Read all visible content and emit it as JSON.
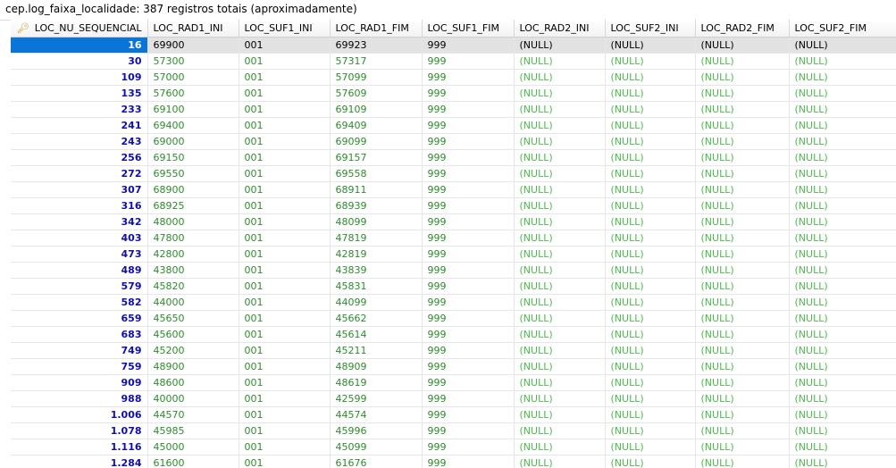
{
  "title": "cep.log_faixa_localidade: 387 registros totais (aproximadamente)",
  "columns": [
    "LOC_NU_SEQUENCIAL",
    "LOC_RAD1_INI",
    "LOC_SUF1_INI",
    "LOC_RAD1_FIM",
    "LOC_SUF1_FIM",
    "LOC_RAD2_INI",
    "LOC_SUF2_INI",
    "LOC_RAD2_FIM",
    "LOC_SUF2_FIM"
  ],
  "primary_key_icon": "key-icon",
  "colors": {
    "selected_cell": "#0a74d8",
    "selected_row": "#e2e2e2",
    "seq_text": "#1010a8",
    "value_text": "#2f8a2f",
    "null_text": "#4fb84f"
  },
  "null_label": "(NULL)",
  "selected_row_index": 0,
  "rows": [
    {
      "seq": "16",
      "rad1_ini": "69900",
      "suf1_ini": "001",
      "rad1_fim": "69923",
      "suf1_fim": "999"
    },
    {
      "seq": "30",
      "rad1_ini": "57300",
      "suf1_ini": "001",
      "rad1_fim": "57317",
      "suf1_fim": "999"
    },
    {
      "seq": "109",
      "rad1_ini": "57000",
      "suf1_ini": "001",
      "rad1_fim": "57099",
      "suf1_fim": "999"
    },
    {
      "seq": "135",
      "rad1_ini": "57600",
      "suf1_ini": "001",
      "rad1_fim": "57609",
      "suf1_fim": "999"
    },
    {
      "seq": "233",
      "rad1_ini": "69100",
      "suf1_ini": "001",
      "rad1_fim": "69109",
      "suf1_fim": "999"
    },
    {
      "seq": "241",
      "rad1_ini": "69400",
      "suf1_ini": "001",
      "rad1_fim": "69409",
      "suf1_fim": "999"
    },
    {
      "seq": "243",
      "rad1_ini": "69000",
      "suf1_ini": "001",
      "rad1_fim": "69099",
      "suf1_fim": "999"
    },
    {
      "seq": "256",
      "rad1_ini": "69150",
      "suf1_ini": "001",
      "rad1_fim": "69157",
      "suf1_fim": "999"
    },
    {
      "seq": "272",
      "rad1_ini": "69550",
      "suf1_ini": "001",
      "rad1_fim": "69558",
      "suf1_fim": "999"
    },
    {
      "seq": "307",
      "rad1_ini": "68900",
      "suf1_ini": "001",
      "rad1_fim": "68911",
      "suf1_fim": "999"
    },
    {
      "seq": "316",
      "rad1_ini": "68925",
      "suf1_ini": "001",
      "rad1_fim": "68939",
      "suf1_fim": "999"
    },
    {
      "seq": "342",
      "rad1_ini": "48000",
      "suf1_ini": "001",
      "rad1_fim": "48099",
      "suf1_fim": "999"
    },
    {
      "seq": "403",
      "rad1_ini": "47800",
      "suf1_ini": "001",
      "rad1_fim": "47819",
      "suf1_fim": "999"
    },
    {
      "seq": "473",
      "rad1_ini": "42800",
      "suf1_ini": "001",
      "rad1_fim": "42819",
      "suf1_fim": "999"
    },
    {
      "seq": "489",
      "rad1_ini": "43800",
      "suf1_ini": "001",
      "rad1_fim": "43839",
      "suf1_fim": "999"
    },
    {
      "seq": "579",
      "rad1_ini": "45820",
      "suf1_ini": "001",
      "rad1_fim": "45831",
      "suf1_fim": "999"
    },
    {
      "seq": "582",
      "rad1_ini": "44000",
      "suf1_ini": "001",
      "rad1_fim": "44099",
      "suf1_fim": "999"
    },
    {
      "seq": "659",
      "rad1_ini": "45650",
      "suf1_ini": "001",
      "rad1_fim": "45662",
      "suf1_fim": "999"
    },
    {
      "seq": "683",
      "rad1_ini": "45600",
      "suf1_ini": "001",
      "rad1_fim": "45614",
      "suf1_fim": "999"
    },
    {
      "seq": "749",
      "rad1_ini": "45200",
      "suf1_ini": "001",
      "rad1_fim": "45211",
      "suf1_fim": "999"
    },
    {
      "seq": "759",
      "rad1_ini": "48900",
      "suf1_ini": "001",
      "rad1_fim": "48909",
      "suf1_fim": "999"
    },
    {
      "seq": "909",
      "rad1_ini": "48600",
      "suf1_ini": "001",
      "rad1_fim": "48619",
      "suf1_fim": "999"
    },
    {
      "seq": "988",
      "rad1_ini": "40000",
      "suf1_ini": "001",
      "rad1_fim": "42599",
      "suf1_fim": "999"
    },
    {
      "seq": "1.006",
      "rad1_ini": "44570",
      "suf1_ini": "001",
      "rad1_fim": "44574",
      "suf1_fim": "999"
    },
    {
      "seq": "1.078",
      "rad1_ini": "45985",
      "suf1_ini": "001",
      "rad1_fim": "45996",
      "suf1_fim": "999"
    },
    {
      "seq": "1.116",
      "rad1_ini": "45000",
      "suf1_ini": "001",
      "rad1_fim": "45099",
      "suf1_fim": "999"
    },
    {
      "seq": "1.284",
      "rad1_ini": "61600",
      "suf1_ini": "001",
      "rad1_fim": "61676",
      "suf1_fim": "999"
    }
  ]
}
